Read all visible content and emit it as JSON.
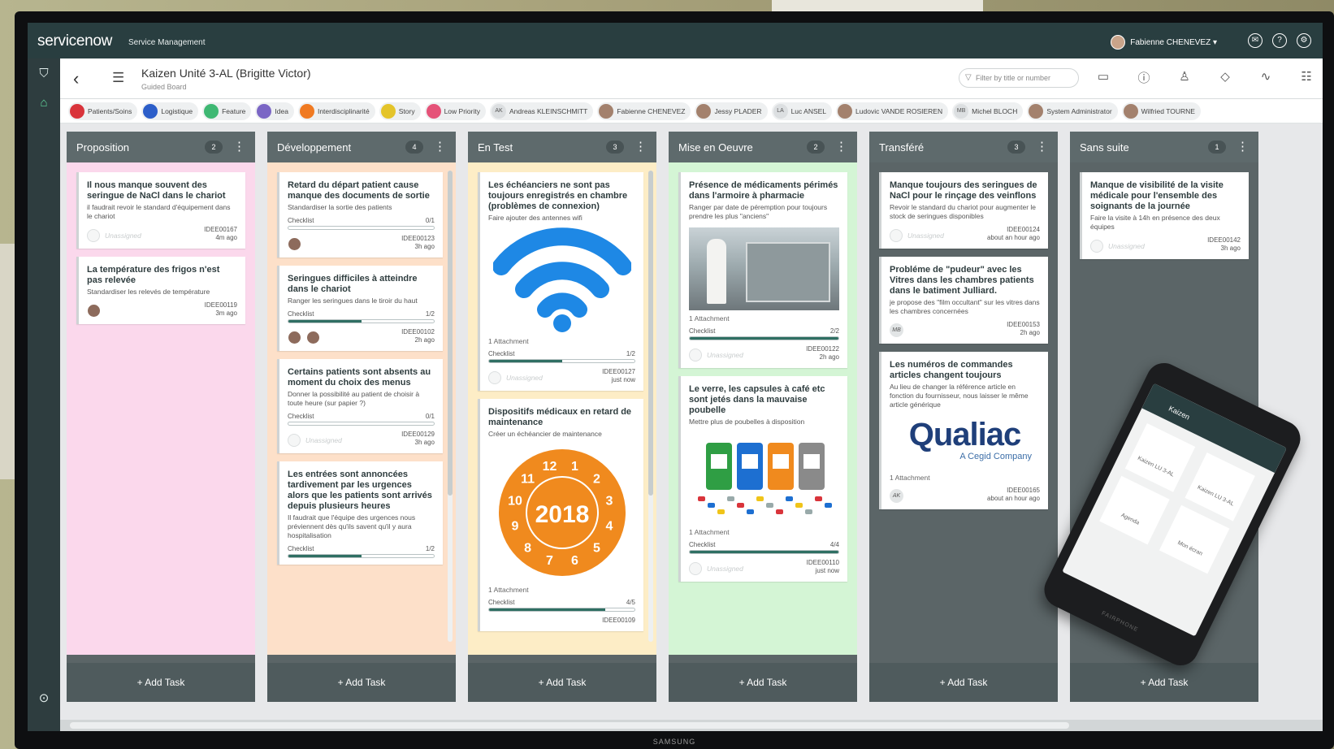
{
  "app": {
    "logo": "servicenow",
    "subtitle": "Service Management",
    "user_name": "Fabienne CHENEVEZ ▾",
    "tv_brand": "SAMSUNG"
  },
  "board": {
    "title": "Kaizen Unité 3-AL (Brigitte Victor)",
    "subtitle": "Guided Board",
    "filter_placeholder": "Filter by title or number"
  },
  "chips": [
    {
      "type": "dot",
      "label": "Patients/Soins",
      "color": "#d9343b"
    },
    {
      "type": "dot",
      "label": "Logistique",
      "color": "#2c5ec9"
    },
    {
      "type": "dot",
      "label": "Feature",
      "color": "#3fb873"
    },
    {
      "type": "dot",
      "label": "Idea",
      "color": "#7b66c5"
    },
    {
      "type": "dot",
      "label": "Interdisciplinarité",
      "color": "#f07a22"
    },
    {
      "type": "dot",
      "label": "Story",
      "color": "#e4c42a"
    },
    {
      "type": "dot",
      "label": "Low Priority",
      "color": "#e55278"
    },
    {
      "type": "ini",
      "initials": "AK",
      "label": "Andreas KLEINSCHMITT"
    },
    {
      "type": "pic",
      "label": "Fabienne CHENEVEZ"
    },
    {
      "type": "pic",
      "label": "Jessy PLADER"
    },
    {
      "type": "ini",
      "initials": "LA",
      "label": "Luc ANSEL"
    },
    {
      "type": "pic",
      "label": "Ludovic VANDE ROSIEREN"
    },
    {
      "type": "ini",
      "initials": "MB",
      "label": "Michel BLOCH"
    },
    {
      "type": "pic",
      "label": "System Administrator"
    },
    {
      "type": "pic",
      "label": "Wilfried TOURNE"
    }
  ],
  "add_task_label": "+ Add Task",
  "columns": [
    {
      "name": "Proposition",
      "count": "2",
      "bg": "#fbd8ec",
      "cards": [
        {
          "title": "Il nous manque souvent des seringue de NaCl dans le chariot",
          "desc": "il faudrait revoir le standard d'équipement dans le chariot",
          "assignee": "Unassigned",
          "id": "IDEE00167",
          "time": "4m ago"
        },
        {
          "title": "La température des frigos n'est pas relevée",
          "desc": "Standardiser les relevés de température",
          "face": true,
          "id": "IDEE00119",
          "time": "3m ago"
        }
      ]
    },
    {
      "name": "Développement",
      "count": "4",
      "bg": "#fde0c9",
      "cards": [
        {
          "title": "Retard du départ patient cause manque des documents de sortie",
          "desc": "Standardiser la sortie des patients",
          "checklist": "Checklist",
          "check": "0/1",
          "fill": 0,
          "face": true,
          "id": "IDEE00123",
          "time": "3h ago"
        },
        {
          "title": "Seringues difficiles à atteindre dans le chariot",
          "desc": "Ranger les seringues dans le tiroir du haut",
          "checklist": "Checklist",
          "check": "1/2",
          "fill": 0.5,
          "face": true,
          "face2": true,
          "id": "IDEE00102",
          "time": "2h ago"
        },
        {
          "title": "Certains patients sont absents au moment du choix des menus",
          "desc": "Donner la possibilité au patient de choisir à toute heure (sur papier ?)",
          "checklist": "Checklist",
          "check": "0/1",
          "fill": 0,
          "assignee": "Unassigned",
          "id": "IDEE00129",
          "time": "3h ago"
        },
        {
          "title": "Les entrées sont annoncées tardivement par les urgences alors que les patients sont arrivés depuis plusieurs heures",
          "desc": "Il faudrait que l'équipe des urgences nous préviennent dès qu'ils savent qu'il y aura hospitalisation",
          "checklist": "Checklist",
          "check": "1/2",
          "fill": 0.5
        }
      ]
    },
    {
      "name": "En Test",
      "count": "3",
      "bg": "#fdedc6",
      "cards": [
        {
          "title": "Les échéanciers ne sont pas toujours enregistrés en chambre (problèmes de connexion)",
          "desc": "Faire ajouter des antennes wifi",
          "image": "wifi",
          "attach": "1 Attachment",
          "checklist": "Checklist",
          "check": "1/2",
          "fill": 0.5,
          "assignee": "Unassigned",
          "id": "IDEE00127",
          "time": "just now"
        },
        {
          "title": "Dispositifs médicaux en retard de maintenance",
          "desc": "Créer un échéancier de maintenance",
          "image": "seal",
          "seal_year": "2018",
          "attach": "1 Attachment",
          "checklist": "Checklist",
          "check": "4/5",
          "fill": 0.8,
          "id": "IDEE00109"
        }
      ]
    },
    {
      "name": "Mise en Oeuvre",
      "count": "2",
      "bg": "#d4f5d5",
      "cards": [
        {
          "title": "Présence de médicaments périmés dans l'armoire à pharmacie",
          "desc": "Ranger par date de péremption pour toujours prendre les plus \"anciens\"",
          "image": "photo",
          "attach": "1 Attachment",
          "checklist": "Checklist",
          "check": "2/2",
          "fill": 1,
          "assignee": "Unassigned",
          "id": "IDEE00122",
          "time": "2h ago"
        },
        {
          "title": "Le verre, les capsules à café etc sont jetés dans la mauvaise poubelle",
          "desc": "Mettre plus de poubelles à disposition",
          "image": "bins",
          "attach": "1 Attachment",
          "checklist": "Checklist",
          "check": "4/4",
          "fill": 1,
          "assignee": "Unassigned",
          "id": "IDEE00110",
          "time": "just now"
        }
      ]
    },
    {
      "name": "Transféré",
      "count": "3",
      "bg": "#5b6567",
      "cards": [
        {
          "title": "Manque toujours des seringues de NaCl pour le rinçage des veinflons",
          "desc": "Revoir le standard du chariot pour augmenter le stock de seringues disponibles",
          "assignee": "Unassigned",
          "id": "IDEE00124",
          "time": "about an hour ago"
        },
        {
          "title": "Probléme de \"pudeur\" avec les Vitres dans les chambres patients dans le batiment Julliard.",
          "desc": "je propose des \"film occultant\" sur les vitres dans les chambres concernées",
          "initials": "MB",
          "id": "IDEE00153",
          "time": "2h ago"
        },
        {
          "title": "Les numéros de commandes articles changent toujours",
          "desc": "Au lieu de changer la référence article en fonction du fournisseur, nous laisser le même article générique",
          "image": "qualiac",
          "logo_text": "Qualiac",
          "logo_sub": "A Cegid Company",
          "attach": "1 Attachment",
          "initials": "AK",
          "id": "IDEE00165",
          "time": "about an hour ago"
        }
      ]
    },
    {
      "name": "Sans suite",
      "count": "1",
      "bg": "#5b6567",
      "cards": [
        {
          "title": "Manque de visibilité de la visite médicale pour l'ensemble des soignants de la journée",
          "desc": "Faire la visite à 14h en présence des deux équipes",
          "assignee": "Unassigned",
          "id": "IDEE00142",
          "time": "3h ago"
        }
      ]
    }
  ],
  "phone": {
    "title": "Kaizen",
    "tiles": [
      "Kaizen LU 3-AL",
      "Kaizen LU 3-AL",
      "Agenda",
      "Mon écran"
    ],
    "brand": "FAIRPHONE"
  }
}
